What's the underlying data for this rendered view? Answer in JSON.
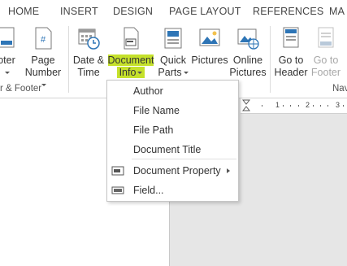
{
  "tabs": [
    "HOME",
    "INSERT",
    "DESIGN",
    "PAGE LAYOUT",
    "REFERENCES",
    "MA"
  ],
  "ribbon": {
    "footer": {
      "line1": "oter",
      "line2": ""
    },
    "page_number": {
      "line1": "Page",
      "line2": "Number"
    },
    "date_time": {
      "line1": "Date &",
      "line2": "Time"
    },
    "document_info": {
      "line1": "Document",
      "line2": "Info"
    },
    "quick_parts": {
      "line1": "Quick",
      "line2": "Parts"
    },
    "pictures": {
      "line1": "Pictures",
      "line2": ""
    },
    "online_pictures": {
      "line1": "Online",
      "line2": "Pictures"
    },
    "goto_header": {
      "line1": "Go to",
      "line2": "Header"
    },
    "goto_footer": {
      "line1": "Go to",
      "line2": "Footer"
    },
    "group_header_footer": "r & Footer",
    "group_nav": "Nav",
    "highlight_color": "#c5e12b"
  },
  "menu": {
    "items": [
      "Author",
      "File Name",
      "File Path",
      "Document Title",
      "Document Property",
      "Field..."
    ]
  },
  "ruler": {
    "marks": [
      "1",
      "2",
      "3"
    ]
  }
}
